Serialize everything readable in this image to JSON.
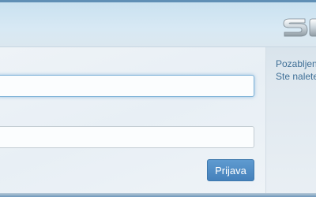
{
  "login": {
    "username_value": "",
    "password_value": "",
    "submit_label": "Prijava"
  },
  "side_message": {
    "line1": "Pozabljen",
    "line2": "Ste nalete"
  },
  "colors": {
    "accent": "#4a86bf",
    "link_text": "#3f6f96",
    "focus_border": "#7fb3d8"
  },
  "icons": {
    "logo": "brand-logo-icon"
  }
}
